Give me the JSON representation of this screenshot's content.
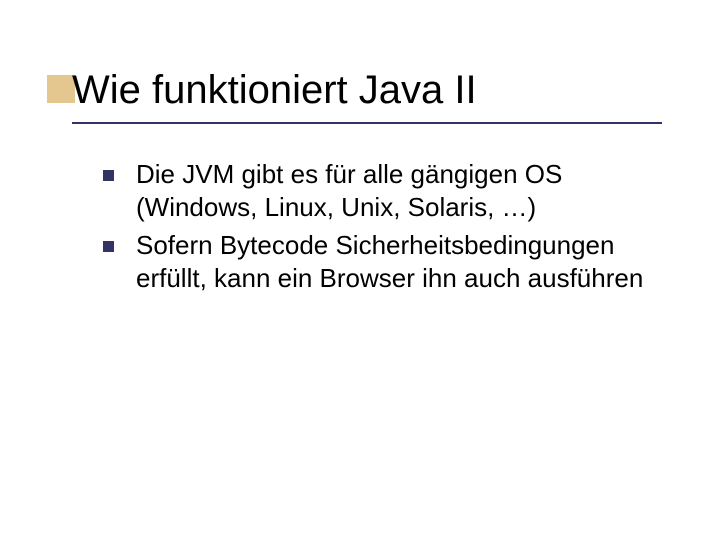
{
  "title": "Wie funktioniert Java II",
  "bullets": [
    "Die JVM gibt es für alle gängigen OS (Windows, Linux, Unix, Solaris, …)",
    "Sofern Bytecode Sicherheitsbedingungen erfüllt, kann ein Browser ihn auch ausführen"
  ]
}
